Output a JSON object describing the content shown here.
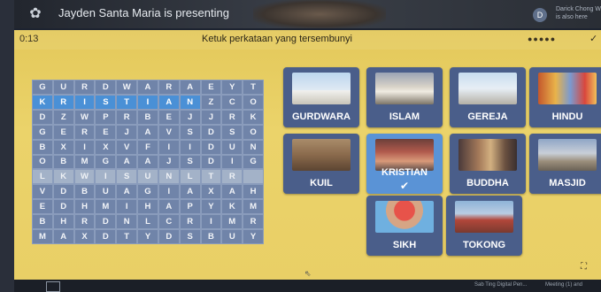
{
  "meeting": {
    "presenter_text": "Jayden Santa Maria is presenting",
    "participant_initial": "D",
    "participant_name": "Darick Chong W",
    "participant_status": "is also here"
  },
  "game": {
    "timer": "0:13",
    "instruction": "Ketuk perkataan yang tersembunyi",
    "progress_dots": "●●●●●"
  },
  "grid": [
    [
      "G",
      "U",
      "R",
      "D",
      "W",
      "A",
      "R",
      "A",
      "E",
      "Y",
      "T"
    ],
    [
      "K",
      "R",
      "I",
      "S",
      "T",
      "I",
      "A",
      "N",
      "Z",
      "C",
      "O"
    ],
    [
      "D",
      "Z",
      "W",
      "P",
      "R",
      "B",
      "E",
      "J",
      "J",
      "R",
      "K"
    ],
    [
      "G",
      "E",
      "R",
      "E",
      "J",
      "A",
      "V",
      "S",
      "D",
      "S",
      "O"
    ],
    [
      "B",
      "X",
      "I",
      "X",
      "V",
      "F",
      "I",
      "I",
      "D",
      "U",
      "N"
    ],
    [
      "O",
      "B",
      "M",
      "G",
      "A",
      "A",
      "J",
      "S",
      "D",
      "I",
      "G"
    ],
    [
      "L",
      "K",
      "W",
      "I",
      "S",
      "U",
      "N",
      "L",
      "T",
      "R",
      ""
    ],
    [
      "V",
      "D",
      "B",
      "U",
      "A",
      "G",
      "I",
      "A",
      "X",
      "A",
      "H"
    ],
    [
      "E",
      "D",
      "H",
      "M",
      "I",
      "H",
      "A",
      "P",
      "Y",
      "K",
      "M"
    ],
    [
      "B",
      "H",
      "R",
      "D",
      "N",
      "L",
      "C",
      "R",
      "I",
      "M",
      "R"
    ],
    [
      "M",
      "A",
      "X",
      "D",
      "T",
      "Y",
      "D",
      "S",
      "B",
      "U",
      "Y"
    ]
  ],
  "tiles": [
    {
      "label": "GURDWARA",
      "found": false
    },
    {
      "label": "ISLAM",
      "found": false
    },
    {
      "label": "GEREJA",
      "found": false
    },
    {
      "label": "HINDU",
      "found": false
    },
    {
      "label": "KUIL",
      "found": false
    },
    {
      "label": "KRISTIAN",
      "found": true
    },
    {
      "label": "BUDDHA",
      "found": false
    },
    {
      "label": "MASJID",
      "found": false
    },
    {
      "label": "SIKH",
      "found": false
    },
    {
      "label": "TOKONG",
      "found": false
    }
  ],
  "taskbar": {
    "item1": "Sab Ting Digital Pen...",
    "item2": "Meeting (1) and"
  },
  "colors": {
    "game_bg": "#e9cf66",
    "tile_bg": "#4a5e8a",
    "tile_found": "#5a93d6",
    "grid_cell": "#7084a9",
    "grid_highlight": "#4a90d6"
  }
}
